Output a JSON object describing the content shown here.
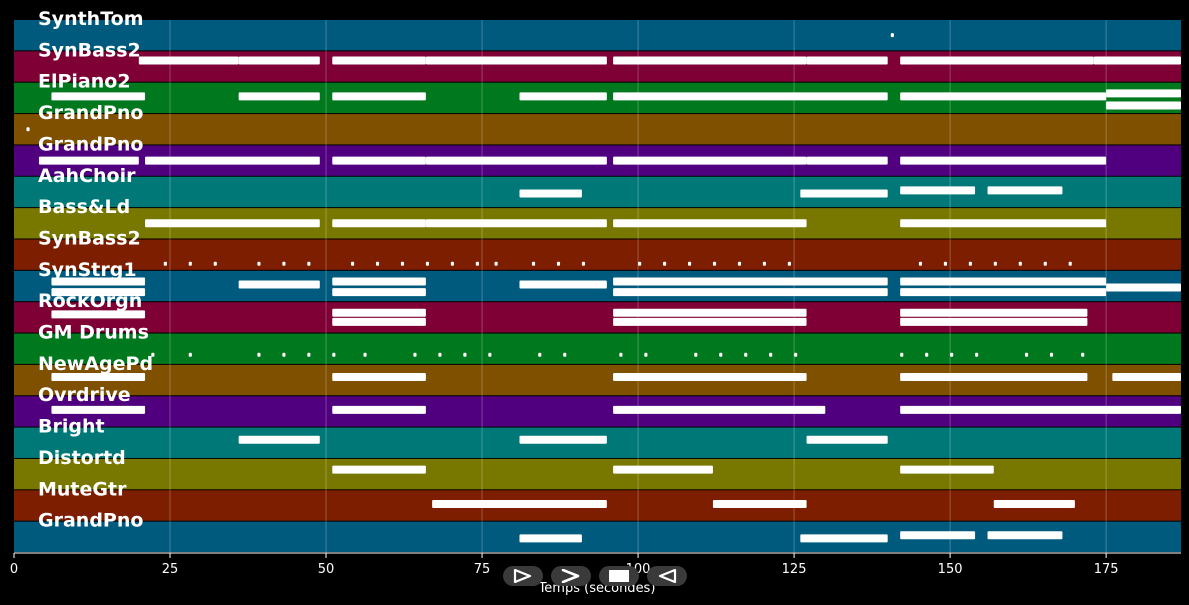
{
  "chart_data": {
    "type": "piano-roll",
    "xlabel": "Temps (secondes)",
    "xlim": [
      0,
      187
    ],
    "x_ticks": [
      0,
      25,
      50,
      75,
      100,
      125,
      150,
      175
    ],
    "grid": true,
    "tracks": [
      {
        "name": "SynthTom",
        "color": "#005a7e",
        "notes": [
          [
            140.5,
            141,
            0.5
          ]
        ]
      },
      {
        "name": "SynBass2",
        "color": "#7e0035",
        "notes": [
          [
            20,
            36,
            0.3
          ],
          [
            36,
            49,
            0.3
          ],
          [
            51,
            66,
            0.3
          ],
          [
            66,
            95,
            0.3
          ],
          [
            96,
            127,
            0.3
          ],
          [
            127,
            140,
            0.3
          ],
          [
            142,
            173,
            0.3
          ],
          [
            173,
            187,
            0.3
          ]
        ]
      },
      {
        "name": "ElPiano2",
        "color": "#00781e",
        "notes": [
          [
            6,
            21,
            0.45
          ],
          [
            36,
            49,
            0.45
          ],
          [
            51,
            66,
            0.45
          ],
          [
            81,
            95,
            0.45
          ],
          [
            96,
            140,
            0.45
          ],
          [
            142,
            175,
            0.45
          ],
          [
            175,
            187,
            0.35
          ],
          [
            175,
            187,
            0.75
          ]
        ]
      },
      {
        "name": "GrandPno",
        "color": "#7e5000",
        "notes": [
          [
            2,
            2.5,
            0.5
          ]
        ]
      },
      {
        "name": "GrandPno",
        "color": "#50007e",
        "notes": [
          [
            4,
            20,
            0.5
          ],
          [
            21,
            49,
            0.5
          ],
          [
            51,
            66,
            0.5
          ],
          [
            66,
            95,
            0.5
          ],
          [
            96,
            127,
            0.5
          ],
          [
            127,
            140,
            0.5
          ],
          [
            142,
            175,
            0.5
          ]
        ]
      },
      {
        "name": "AahChoir",
        "color": "#007878",
        "notes": [
          [
            81,
            91,
            0.55
          ],
          [
            126,
            140,
            0.55
          ],
          [
            142,
            154,
            0.45
          ],
          [
            156,
            168,
            0.45
          ]
        ]
      },
      {
        "name": "Bass&Ld",
        "color": "#787800",
        "notes": [
          [
            21,
            49,
            0.5
          ],
          [
            51,
            66,
            0.5
          ],
          [
            66,
            95,
            0.5
          ],
          [
            96,
            127,
            0.5
          ],
          [
            142,
            175,
            0.5
          ]
        ]
      },
      {
        "name": "SynBass2",
        "color": "#7e1e00",
        "notes": [
          [
            24,
            24.5,
            0.8
          ],
          [
            28,
            28.5,
            0.8
          ],
          [
            32,
            32.5,
            0.8
          ],
          [
            39,
            39.5,
            0.8
          ],
          [
            43,
            43.5,
            0.8
          ],
          [
            47,
            47.5,
            0.8
          ],
          [
            54,
            54.5,
            0.8
          ],
          [
            58,
            58.5,
            0.8
          ],
          [
            62,
            62.5,
            0.8
          ],
          [
            66,
            66.5,
            0.8
          ],
          [
            70,
            70.5,
            0.8
          ],
          [
            74,
            74.5,
            0.8
          ],
          [
            77,
            77.5,
            0.8
          ],
          [
            83,
            83.5,
            0.8
          ],
          [
            87,
            87.5,
            0.8
          ],
          [
            91,
            91.5,
            0.8
          ],
          [
            100,
            100.5,
            0.8
          ],
          [
            104,
            104.5,
            0.8
          ],
          [
            108,
            108.5,
            0.8
          ],
          [
            112,
            112.5,
            0.8
          ],
          [
            116,
            116.5,
            0.8
          ],
          [
            120,
            120.5,
            0.8
          ],
          [
            124,
            124.5,
            0.8
          ],
          [
            145,
            145.5,
            0.8
          ],
          [
            149,
            149.5,
            0.8
          ],
          [
            153,
            153.5,
            0.8
          ],
          [
            157,
            157.5,
            0.8
          ],
          [
            161,
            161.5,
            0.8
          ],
          [
            165,
            165.5,
            0.8
          ],
          [
            169,
            169.5,
            0.8
          ]
        ]
      },
      {
        "name": "SynStrg1",
        "color": "#005a7e",
        "notes": [
          [
            6,
            21,
            0.35
          ],
          [
            6,
            21,
            0.7
          ],
          [
            36,
            49,
            0.45
          ],
          [
            51,
            66,
            0.35
          ],
          [
            51,
            66,
            0.7
          ],
          [
            81,
            95,
            0.45
          ],
          [
            96,
            140,
            0.35
          ],
          [
            96,
            140,
            0.7
          ],
          [
            142,
            175,
            0.35
          ],
          [
            142,
            175,
            0.7
          ],
          [
            175,
            187,
            0.55
          ]
        ]
      },
      {
        "name": "RockOrgn",
        "color": "#7e0035",
        "notes": [
          [
            6,
            21,
            0.4
          ],
          [
            51,
            66,
            0.35
          ],
          [
            51,
            66,
            0.65
          ],
          [
            96,
            127,
            0.35
          ],
          [
            96,
            127,
            0.65
          ],
          [
            142,
            172,
            0.35
          ],
          [
            142,
            172,
            0.65
          ]
        ]
      },
      {
        "name": "GM Drums",
        "color": "#00781e",
        "notes": [
          [
            22,
            22.5,
            0.7
          ],
          [
            28,
            28.5,
            0.7
          ],
          [
            39,
            39.5,
            0.7
          ],
          [
            43,
            43.5,
            0.7
          ],
          [
            47,
            47.5,
            0.7
          ],
          [
            51,
            51.5,
            0.7
          ],
          [
            56,
            56.5,
            0.7
          ],
          [
            64,
            64.5,
            0.7
          ],
          [
            68,
            68.5,
            0.7
          ],
          [
            72,
            72.5,
            0.7
          ],
          [
            76,
            76.5,
            0.7
          ],
          [
            84,
            84.5,
            0.7
          ],
          [
            88,
            88.5,
            0.7
          ],
          [
            97,
            97.5,
            0.7
          ],
          [
            101,
            101.5,
            0.7
          ],
          [
            109,
            109.5,
            0.7
          ],
          [
            113,
            113.5,
            0.7
          ],
          [
            117,
            117.5,
            0.7
          ],
          [
            121,
            121.5,
            0.7
          ],
          [
            125,
            125.5,
            0.7
          ],
          [
            142,
            142.5,
            0.7
          ],
          [
            146,
            146.5,
            0.7
          ],
          [
            150,
            150.5,
            0.7
          ],
          [
            154,
            154.5,
            0.7
          ],
          [
            162,
            162.5,
            0.7
          ],
          [
            166,
            166.5,
            0.7
          ],
          [
            171,
            171.5,
            0.7
          ]
        ]
      },
      {
        "name": "NewAgePd",
        "color": "#7e5000",
        "notes": [
          [
            6,
            21,
            0.4
          ],
          [
            51,
            66,
            0.4
          ],
          [
            96,
            127,
            0.4
          ],
          [
            142,
            172,
            0.4
          ],
          [
            176,
            187,
            0.4
          ]
        ]
      },
      {
        "name": "Ovrdrive",
        "color": "#50007e",
        "notes": [
          [
            6,
            21,
            0.45
          ],
          [
            51,
            66,
            0.45
          ],
          [
            96,
            130,
            0.45
          ],
          [
            142,
            187,
            0.45
          ]
        ]
      },
      {
        "name": "Bright",
        "color": "#007878",
        "notes": [
          [
            36,
            49,
            0.4
          ],
          [
            81,
            95,
            0.4
          ],
          [
            127,
            140,
            0.4
          ]
        ]
      },
      {
        "name": "Distortd",
        "color": "#787800",
        "notes": [
          [
            51,
            66,
            0.35
          ],
          [
            96,
            112,
            0.35
          ],
          [
            142,
            157,
            0.35
          ]
        ]
      },
      {
        "name": "MuteGtr",
        "color": "#7e1e00",
        "notes": [
          [
            67,
            95,
            0.45
          ],
          [
            112,
            127,
            0.45
          ],
          [
            157,
            170,
            0.45
          ]
        ]
      },
      {
        "name": "GrandPno",
        "color": "#005a7e",
        "notes": [
          [
            81,
            91,
            0.55
          ],
          [
            126,
            140,
            0.55
          ],
          [
            142,
            154,
            0.45
          ],
          [
            156,
            168,
            0.45
          ]
        ]
      }
    ]
  }
}
